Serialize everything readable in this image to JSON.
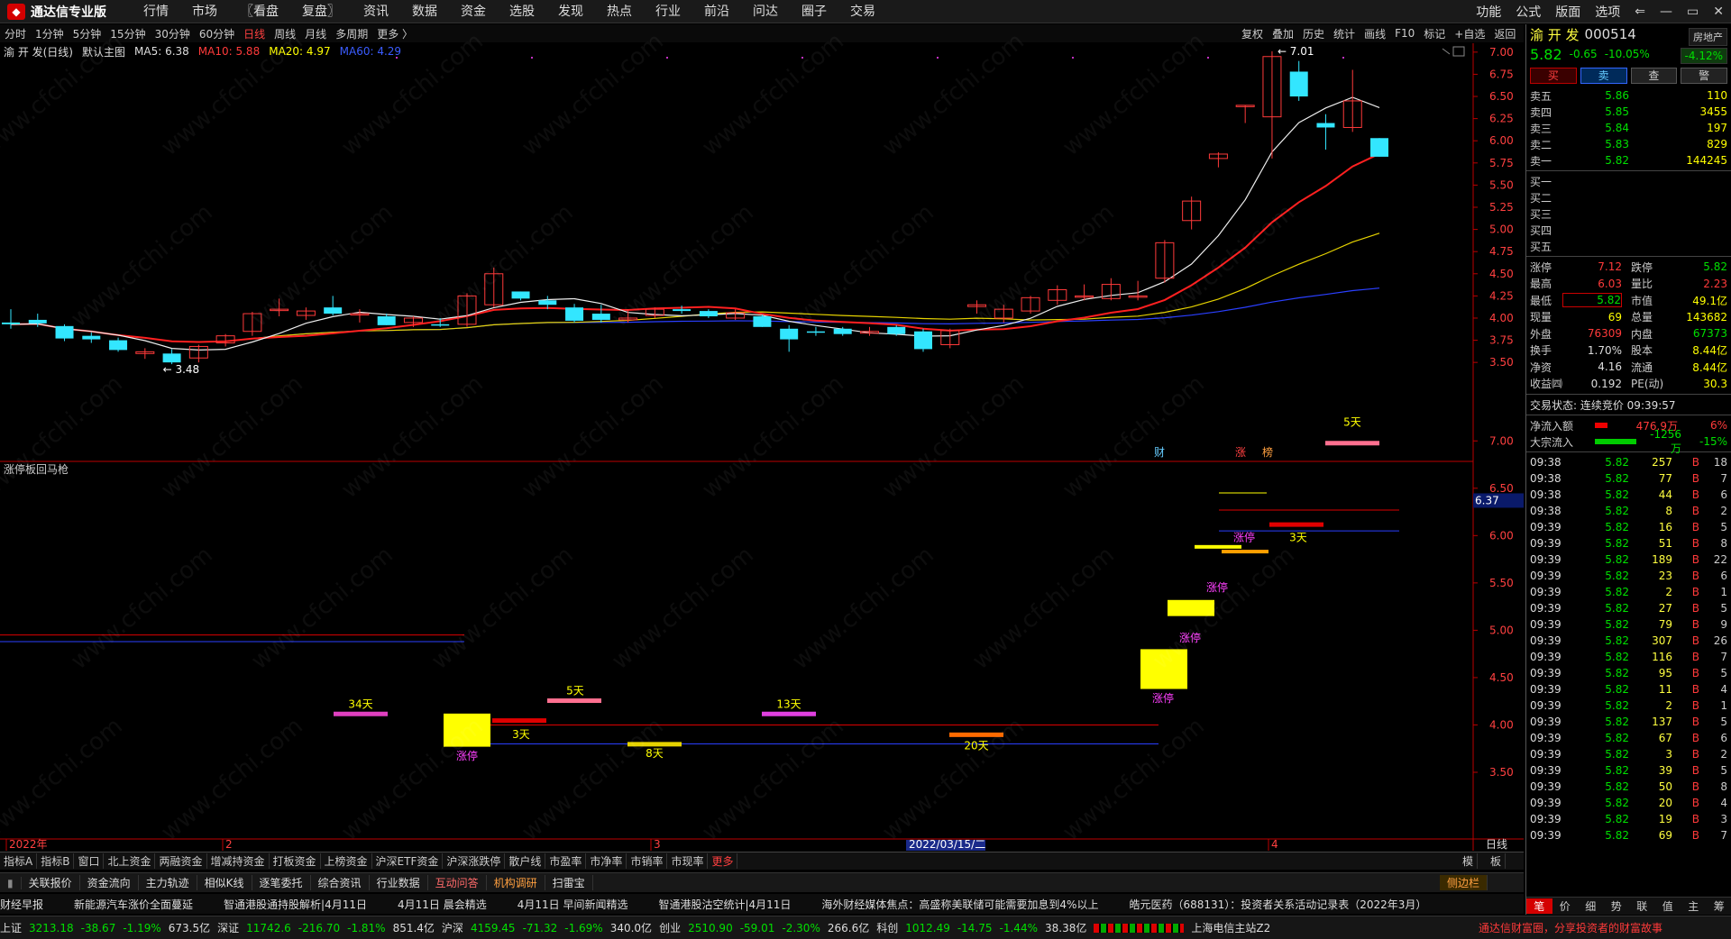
{
  "app": {
    "title": "通达信专业版"
  },
  "menu": [
    "行情",
    "市场",
    "〖看盘",
    "复盘〗",
    "资讯",
    "数据",
    "资金",
    "选股",
    "发现",
    "热点",
    "行业",
    "前沿",
    "问达",
    "圈子",
    "交易"
  ],
  "menu_right": [
    "功能",
    "公式",
    "版面",
    "选项"
  ],
  "window_controls": [
    "⇐",
    "—",
    "▭",
    "✕"
  ],
  "periods": [
    "分时",
    "1分钟",
    "5分钟",
    "15分钟",
    "30分钟",
    "60分钟",
    "日线",
    "周线",
    "月线",
    "多周期",
    "更多 〉"
  ],
  "active_period": "日线",
  "chart_tools": [
    "复权",
    "叠加",
    "历史",
    "统计",
    "画线",
    "F10",
    "标记",
    "+自选",
    "返回"
  ],
  "main_info": {
    "name": "渝 开 发(日线)",
    "mode": "默认主图",
    "ma5": "MA5: 6.38",
    "ma10": "MA10: 5.88",
    "ma20": "MA20: 4.97",
    "ma60": "MA60: 4.29"
  },
  "sub_info": {
    "name": "涨停板回马枪"
  },
  "price_labels": [
    "7.00",
    "6.75",
    "6.50",
    "6.25",
    "6.00",
    "5.75",
    "5.50",
    "5.25",
    "5.00",
    "4.75",
    "4.50",
    "4.25",
    "4.00",
    "3.75",
    "3.50"
  ],
  "sub_labels": [
    "7.00",
    "6.50",
    "6.00",
    "5.50",
    "5.00",
    "4.50",
    "4.00",
    "3.50"
  ],
  "cursor_value": "6.37",
  "annotations": {
    "high": "← 7.01",
    "low": "← 3.48",
    "fin": "财",
    "zhang": "涨",
    "hong": "榜"
  },
  "xaxis": {
    "y2022": "2022年",
    "m2": "2",
    "m3": "3",
    "m4": "4",
    "cursor_date": "2022/03/15/二",
    "right": "日线"
  },
  "sub_marks": [
    {
      "t": "34天"
    },
    {
      "t": "涨停"
    },
    {
      "t": "3天"
    },
    {
      "t": "5天"
    },
    {
      "t": "8天"
    },
    {
      "t": "13天"
    },
    {
      "t": "20天"
    },
    {
      "t": "涨停"
    },
    {
      "t": "涨停"
    },
    {
      "t": "涨停"
    },
    {
      "t": "涨停"
    },
    {
      "t": "3天"
    },
    {
      "t": "5天"
    }
  ],
  "bottom_tabs": [
    "指标A",
    "指标B",
    "窗口",
    "北上资金",
    "两融资金",
    "增减持资金",
    "打板资金",
    "上榜资金",
    "沪深ETF资金",
    "沪深涨跌停",
    "散户线",
    "市盈率",
    "市净率",
    "市销率",
    "市现率",
    "更多"
  ],
  "bottom_tabs_right": [
    "模",
    "板"
  ],
  "bottom2": [
    "关联报价",
    "资金流向",
    "主力轨迹",
    "相似K线",
    "逐笔委托",
    "综合资讯",
    "行业数据",
    "互动问答",
    "机构调研",
    "扫雷宝"
  ],
  "bottom2_right": "侧边栏",
  "news": [
    "财经早报",
    "新能源汽车涨价全面蔓延",
    "智通港股通持股解析|4月11日",
    "4月11日 晨会精选",
    "4月11日 早间新闻精选",
    "智通港股沽空统计|4月11日",
    "海外财经媒体焦点：高盛称美联储可能需要加息到4%以上",
    "皓元医药（688131）：投资者关系活动记录表（2022年3月）"
  ],
  "status": {
    "sh": {
      "name": "上证",
      "v": "3213.18",
      "c": "-38.67",
      "p": "-1.19%",
      "a": "673.5亿"
    },
    "sz": {
      "name": "深证",
      "v": "11742.6",
      "c": "-216.70",
      "p": "-1.81%",
      "a": "851.4亿"
    },
    "hs": {
      "name": "沪深",
      "v": "4159.45",
      "c": "-71.32",
      "p": "-1.69%",
      "a": "340.0亿"
    },
    "cy": {
      "name": "创业",
      "v": "2510.90",
      "c": "-59.01",
      "p": "-2.30%",
      "a": "266.6亿"
    },
    "kc": {
      "name": "科创",
      "v": "1012.49",
      "c": "-14.75",
      "p": "-1.44%",
      "a": "38.38亿"
    },
    "server": "上海电信主站Z2",
    "promo": "通达信财富圈，分享投资者的财富故事"
  },
  "quote": {
    "name": "渝 开 发",
    "code": "000514",
    "industry": "房地产",
    "price": "5.82",
    "change": "-0.65",
    "pct": "-10.05%",
    "industry_pct": "-4.12%",
    "buttons": [
      "买",
      "卖",
      "查",
      "警"
    ],
    "asks": [
      {
        "l": "卖五",
        "p": "5.86",
        "v": "110"
      },
      {
        "l": "卖四",
        "p": "5.85",
        "v": "3455"
      },
      {
        "l": "卖三",
        "p": "5.84",
        "v": "197"
      },
      {
        "l": "卖二",
        "p": "5.83",
        "v": "829"
      },
      {
        "l": "卖一",
        "p": "5.82",
        "v": "144245"
      }
    ],
    "bids": [
      {
        "l": "买一"
      },
      {
        "l": "买二"
      },
      {
        "l": "买三"
      },
      {
        "l": "买四"
      },
      {
        "l": "买五"
      }
    ],
    "stats": [
      {
        "l1": "涨停",
        "v1": "7.12",
        "l2": "跌停",
        "v2": "5.82"
      },
      {
        "l1": "最高",
        "v1": "6.03",
        "l2": "量比",
        "v2": "2.23"
      },
      {
        "l1": "最低",
        "v1": "5.82",
        "l2": "市值",
        "v2": "49.1亿"
      },
      {
        "l1": "现量",
        "v1": "69",
        "l2": "总量",
        "v2": "143682"
      },
      {
        "l1": "外盘",
        "v1": "76309",
        "l2": "内盘",
        "v2": "67373"
      },
      {
        "l1": "换手",
        "v1": "1.70%",
        "l2": "股本",
        "v2": "8.44亿"
      },
      {
        "l1": "净资",
        "v1": "4.16",
        "l2": "流通",
        "v2": "8.44亿"
      },
      {
        "l1": "收益㈣",
        "v1": "0.192",
        "l2": "PE(动)",
        "v2": "30.3"
      }
    ],
    "trade_state": "交易状态: 连续竞价 09:39:57",
    "netflow": {
      "l": "净流入额",
      "v": "476.9万",
      "p": "6%"
    },
    "bigflow": {
      "l": "大宗流入",
      "v": "-1256万",
      "p": "-15%"
    },
    "ticks": [
      {
        "t": "09:38",
        "p": "5.82",
        "v": "257",
        "bs": "B",
        "n": "18"
      },
      {
        "t": "09:38",
        "p": "5.82",
        "v": "77",
        "bs": "B",
        "n": "7"
      },
      {
        "t": "09:38",
        "p": "5.82",
        "v": "44",
        "bs": "B",
        "n": "6"
      },
      {
        "t": "09:38",
        "p": "5.82",
        "v": "8",
        "bs": "B",
        "n": "2"
      },
      {
        "t": "09:39",
        "p": "5.82",
        "v": "16",
        "bs": "B",
        "n": "5"
      },
      {
        "t": "09:39",
        "p": "5.82",
        "v": "51",
        "bs": "B",
        "n": "8"
      },
      {
        "t": "09:39",
        "p": "5.82",
        "v": "189",
        "bs": "B",
        "n": "22"
      },
      {
        "t": "09:39",
        "p": "5.82",
        "v": "23",
        "bs": "B",
        "n": "6"
      },
      {
        "t": "09:39",
        "p": "5.82",
        "v": "2",
        "bs": "B",
        "n": "1"
      },
      {
        "t": "09:39",
        "p": "5.82",
        "v": "27",
        "bs": "B",
        "n": "5"
      },
      {
        "t": "09:39",
        "p": "5.82",
        "v": "79",
        "bs": "B",
        "n": "9"
      },
      {
        "t": "09:39",
        "p": "5.82",
        "v": "307",
        "bs": "B",
        "n": "26"
      },
      {
        "t": "09:39",
        "p": "5.82",
        "v": "116",
        "bs": "B",
        "n": "7"
      },
      {
        "t": "09:39",
        "p": "5.82",
        "v": "95",
        "bs": "B",
        "n": "5"
      },
      {
        "t": "09:39",
        "p": "5.82",
        "v": "11",
        "bs": "B",
        "n": "4"
      },
      {
        "t": "09:39",
        "p": "5.82",
        "v": "2",
        "bs": "B",
        "n": "1"
      },
      {
        "t": "09:39",
        "p": "5.82",
        "v": "137",
        "bs": "B",
        "n": "5"
      },
      {
        "t": "09:39",
        "p": "5.82",
        "v": "67",
        "bs": "B",
        "n": "6"
      },
      {
        "t": "09:39",
        "p": "5.82",
        "v": "3",
        "bs": "B",
        "n": "2"
      },
      {
        "t": "09:39",
        "p": "5.82",
        "v": "39",
        "bs": "B",
        "n": "5"
      },
      {
        "t": "09:39",
        "p": "5.82",
        "v": "50",
        "bs": "B",
        "n": "8"
      },
      {
        "t": "09:39",
        "p": "5.82",
        "v": "20",
        "bs": "B",
        "n": "4"
      },
      {
        "t": "09:39",
        "p": "5.82",
        "v": "19",
        "bs": "B",
        "n": "3"
      },
      {
        "t": "09:39",
        "p": "5.82",
        "v": "69",
        "bs": "B",
        "n": "7"
      }
    ],
    "bottom_tabs": [
      "笔",
      "价",
      "细",
      "势",
      "联",
      "值",
      "主",
      "筹"
    ]
  },
  "watermark": "www.cfchi.com",
  "chart_data": {
    "type": "candlestick",
    "title": "渝 开 发(日线)",
    "ylim": [
      3.4,
      7.1
    ],
    "candles": [
      {
        "o": 3.95,
        "h": 4.1,
        "l": 3.88,
        "c": 3.93
      },
      {
        "o": 3.98,
        "h": 4.05,
        "l": 3.9,
        "c": 3.94
      },
      {
        "o": 3.91,
        "h": 3.93,
        "l": 3.74,
        "c": 3.77
      },
      {
        "o": 3.8,
        "h": 3.84,
        "l": 3.72,
        "c": 3.76
      },
      {
        "o": 3.75,
        "h": 3.78,
        "l": 3.62,
        "c": 3.64
      },
      {
        "o": 3.6,
        "h": 3.66,
        "l": 3.54,
        "c": 3.62
      },
      {
        "o": 3.6,
        "h": 3.65,
        "l": 3.48,
        "c": 3.5
      },
      {
        "o": 3.55,
        "h": 3.7,
        "l": 3.5,
        "c": 3.68
      },
      {
        "o": 3.72,
        "h": 3.82,
        "l": 3.68,
        "c": 3.8
      },
      {
        "o": 3.85,
        "h": 4.07,
        "l": 3.8,
        "c": 4.05
      },
      {
        "o": 4.1,
        "h": 4.22,
        "l": 4.02,
        "c": 4.1
      },
      {
        "o": 4.03,
        "h": 4.12,
        "l": 3.98,
        "c": 4.08
      },
      {
        "o": 4.12,
        "h": 4.25,
        "l": 4.03,
        "c": 4.05
      },
      {
        "o": 4.05,
        "h": 4.1,
        "l": 3.95,
        "c": 4.05
      },
      {
        "o": 4.02,
        "h": 4.05,
        "l": 3.92,
        "c": 3.92
      },
      {
        "o": 3.95,
        "h": 4.02,
        "l": 3.9,
        "c": 4.0
      },
      {
        "o": 3.93,
        "h": 4.0,
        "l": 3.9,
        "c": 3.92
      },
      {
        "o": 3.93,
        "h": 4.28,
        "l": 3.9,
        "c": 4.25
      },
      {
        "o": 4.15,
        "h": 4.57,
        "l": 4.12,
        "c": 4.5
      },
      {
        "o": 4.3,
        "h": 4.3,
        "l": 4.2,
        "c": 4.22
      },
      {
        "o": 4.2,
        "h": 4.25,
        "l": 4.1,
        "c": 4.15
      },
      {
        "o": 4.12,
        "h": 4.16,
        "l": 3.95,
        "c": 3.97
      },
      {
        "o": 4.05,
        "h": 4.15,
        "l": 3.95,
        "c": 3.98
      },
      {
        "o": 3.98,
        "h": 4.1,
        "l": 3.95,
        "c": 4.0
      },
      {
        "o": 4.03,
        "h": 4.12,
        "l": 4.0,
        "c": 4.1
      },
      {
        "o": 4.1,
        "h": 4.14,
        "l": 4.05,
        "c": 4.08
      },
      {
        "o": 4.08,
        "h": 4.1,
        "l": 4.0,
        "c": 4.02
      },
      {
        "o": 4.0,
        "h": 4.1,
        "l": 3.98,
        "c": 4.06
      },
      {
        "o": 4.02,
        "h": 4.04,
        "l": 3.9,
        "c": 3.9
      },
      {
        "o": 3.88,
        "h": 3.92,
        "l": 3.62,
        "c": 3.76
      },
      {
        "o": 3.85,
        "h": 3.9,
        "l": 3.8,
        "c": 3.84
      },
      {
        "o": 3.88,
        "h": 3.9,
        "l": 3.8,
        "c": 3.82
      },
      {
        "o": 3.83,
        "h": 3.9,
        "l": 3.8,
        "c": 3.85
      },
      {
        "o": 3.9,
        "h": 3.92,
        "l": 3.8,
        "c": 3.82
      },
      {
        "o": 3.85,
        "h": 3.88,
        "l": 3.62,
        "c": 3.65
      },
      {
        "o": 3.7,
        "h": 3.88,
        "l": 3.66,
        "c": 3.86
      },
      {
        "o": 4.13,
        "h": 4.2,
        "l": 4.05,
        "c": 4.15
      },
      {
        "o": 4.0,
        "h": 4.15,
        "l": 3.95,
        "c": 4.1
      },
      {
        "o": 4.08,
        "h": 4.25,
        "l": 4.05,
        "c": 4.23
      },
      {
        "o": 4.2,
        "h": 4.37,
        "l": 4.15,
        "c": 4.32
      },
      {
        "o": 4.25,
        "h": 4.38,
        "l": 4.2,
        "c": 4.25
      },
      {
        "o": 4.22,
        "h": 4.45,
        "l": 4.2,
        "c": 4.38
      },
      {
        "o": 4.25,
        "h": 4.42,
        "l": 4.2,
        "c": 4.25
      },
      {
        "o": 4.45,
        "h": 4.88,
        "l": 4.4,
        "c": 4.85
      },
      {
        "o": 5.1,
        "h": 5.37,
        "l": 5.0,
        "c": 5.32
      },
      {
        "o": 5.8,
        "h": 5.87,
        "l": 5.7,
        "c": 5.85
      },
      {
        "o": 6.4,
        "h": 6.4,
        "l": 6.2,
        "c": 6.4
      },
      {
        "o": 6.27,
        "h": 7.01,
        "l": 5.8,
        "c": 6.95
      },
      {
        "o": 6.78,
        "h": 6.9,
        "l": 6.45,
        "c": 6.5
      },
      {
        "o": 6.2,
        "h": 6.3,
        "l": 5.9,
        "c": 6.15
      },
      {
        "o": 6.15,
        "h": 6.8,
        "l": 6.1,
        "c": 6.45
      },
      {
        "o": 6.03,
        "h": 6.03,
        "l": 5.82,
        "c": 5.82
      }
    ]
  }
}
